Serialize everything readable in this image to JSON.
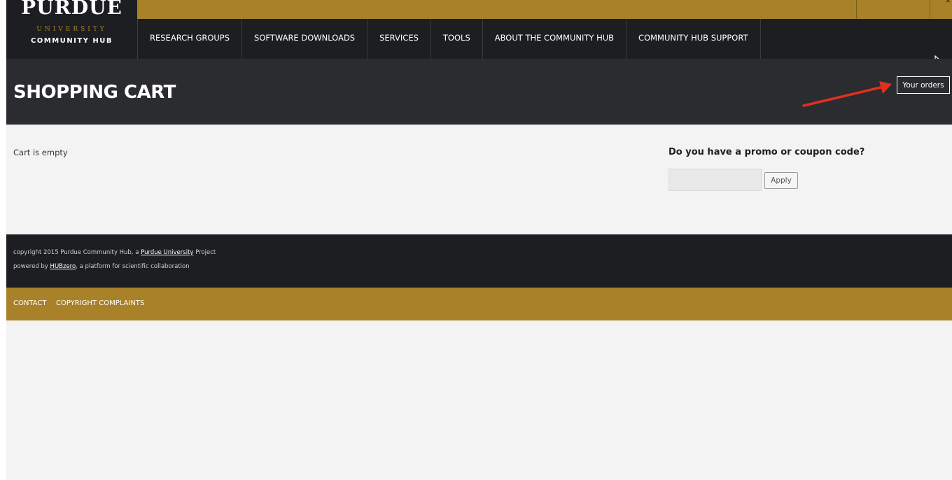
{
  "brand": {
    "name": "PURDUE",
    "subtitle": "UNIVERSITY",
    "hub": "COMMUNITY HUB"
  },
  "nav": {
    "items": [
      {
        "label": "RESEARCH GROUPS"
      },
      {
        "label": "SOFTWARE DOWNLOADS"
      },
      {
        "label": "SERVICES"
      },
      {
        "label": "TOOLS"
      },
      {
        "label": "ABOUT THE COMMUNITY HUB"
      },
      {
        "label": "COMMUNITY HUB SUPPORT"
      }
    ]
  },
  "header": {
    "title": "SHOPPING CART",
    "orders_button": "Your orders"
  },
  "main": {
    "cart_status": "Cart is empty",
    "promo_title": "Do you have a promo or coupon code?",
    "promo_value": "",
    "apply_label": "Apply"
  },
  "footer": {
    "line1_prefix": "copyright 2015 Purdue Community Hub, a ",
    "line1_link": "Purdue University",
    "line1_suffix": " Project",
    "line2_prefix": "powered by ",
    "line2_link": "HUBzero",
    "line2_suffix": ", a platform for scientific collaboration"
  },
  "footer_links": {
    "contact": "CONTACT",
    "copyright": "COPYRIGHT COMPLAINTS"
  },
  "colors": {
    "gold": "#a98129",
    "nav_bg": "#1d1e22",
    "header_bg": "#2a2c2f",
    "arrow": "#e0301e"
  },
  "icons": {
    "cursor": "mouse-pointer-icon",
    "annotation": "red-arrow-icon",
    "close": "close-icon"
  }
}
